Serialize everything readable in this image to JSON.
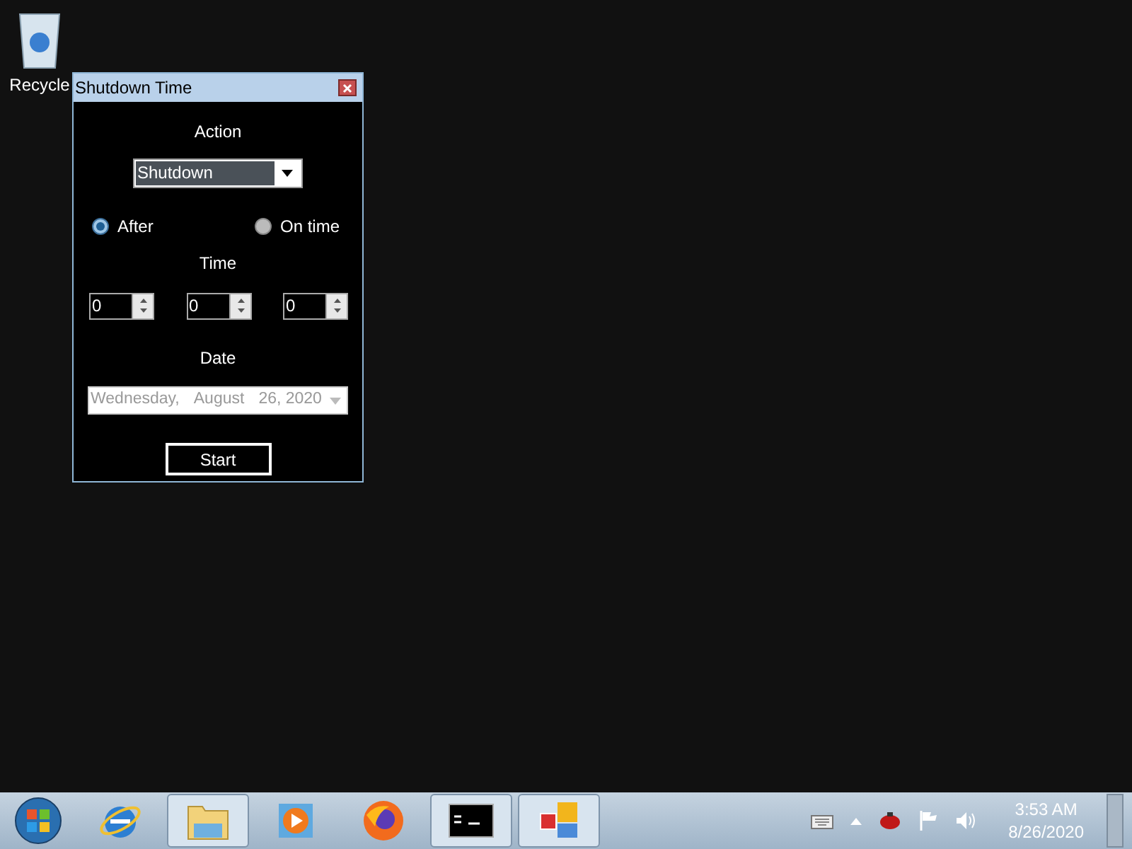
{
  "desktop_icons": [
    {
      "label": "Recycle"
    }
  ],
  "window": {
    "title": "Shutdown Time",
    "action_label": "Action",
    "action_value": "Shutdown",
    "modes": [
      {
        "label": "After",
        "selected": true
      },
      {
        "label": "On time",
        "selected": false
      }
    ],
    "time_label": "Time",
    "spinners": [
      {
        "value": "0"
      },
      {
        "value": "0"
      },
      {
        "value": "0"
      }
    ],
    "date_label": "Date",
    "date_parts": [
      "Wednesday,",
      "August",
      "26, 2020"
    ],
    "start_button": "Start"
  },
  "taskbar": {
    "items": [
      {
        "kind": "ie",
        "active": false
      },
      {
        "kind": "folder",
        "active": true
      },
      {
        "kind": "media",
        "active": false
      },
      {
        "kind": "firefox",
        "active": false
      },
      {
        "kind": "cmd",
        "active": true
      },
      {
        "kind": "app",
        "active": true
      }
    ],
    "clock_time": "3:53 AM",
    "clock_date": "8/26/2020"
  }
}
